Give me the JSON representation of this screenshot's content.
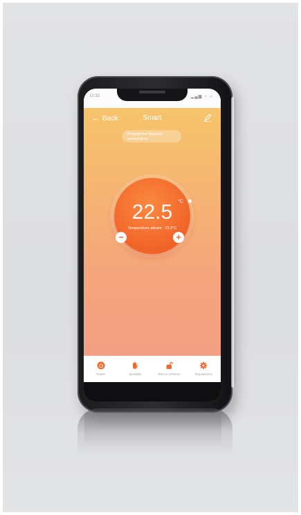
{
  "statusbar": {
    "time": "10:33",
    "icons": "▂▄▆ ◔ ▭"
  },
  "header": {
    "back_label": "Back",
    "title": "Smart"
  },
  "program": {
    "line1": "Programma Manuale",
    "line2": "temperature"
  },
  "thermostat": {
    "setpoint": "22.5",
    "unit": "°C",
    "current_label": "Temperatura attuale : 23.3°C",
    "minus": "−",
    "plus": "+"
  },
  "nav": {
    "items": [
      {
        "label": "Power",
        "icon": "power-icon"
      },
      {
        "label": "Modalità",
        "icon": "hand-icon"
      },
      {
        "label": "Blocco schermo",
        "icon": "lock-icon"
      },
      {
        "label": "Impostazioni",
        "icon": "gear-icon"
      }
    ]
  },
  "colors": {
    "accent": "#f06a2e",
    "gradient_top": "#f6c86a",
    "gradient_bottom": "#f29b87"
  }
}
